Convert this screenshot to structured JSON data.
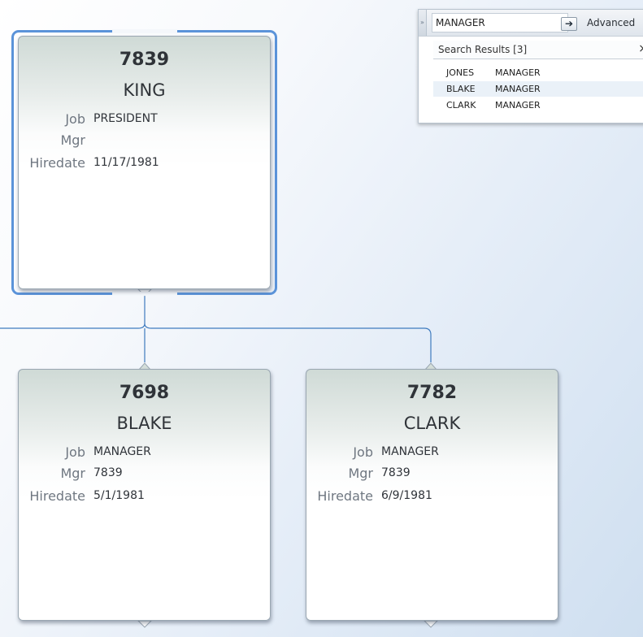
{
  "search": {
    "query": "MANAGER",
    "placeholder": "",
    "go_glyph": "➔",
    "advanced_label": "Advanced",
    "results_label": "Search Results [3]",
    "close_glyph": "×",
    "grip_glyph": "»",
    "results": [
      {
        "name": "JONES",
        "job": "MANAGER"
      },
      {
        "name": "BLAKE",
        "job": "MANAGER"
      },
      {
        "name": "CLARK",
        "job": "MANAGER"
      }
    ]
  },
  "labels": {
    "job": "Job",
    "mgr": "Mgr",
    "hiredate": "Hiredate"
  },
  "nodes": [
    {
      "empno": "7839",
      "ename": "KING",
      "job": "PRESIDENT",
      "mgr": "",
      "hiredate": "11/17/1981",
      "selected": true
    },
    {
      "empno": "7698",
      "ename": "BLAKE",
      "job": "MANAGER",
      "mgr": "7839",
      "hiredate": "5/1/1981",
      "selected": false
    },
    {
      "empno": "7782",
      "ename": "CLARK",
      "job": "MANAGER",
      "mgr": "7839",
      "hiredate": "6/9/1981",
      "selected": false
    }
  ],
  "colors": {
    "selection": "#5b93d9",
    "connector": "#3f7bbf"
  }
}
